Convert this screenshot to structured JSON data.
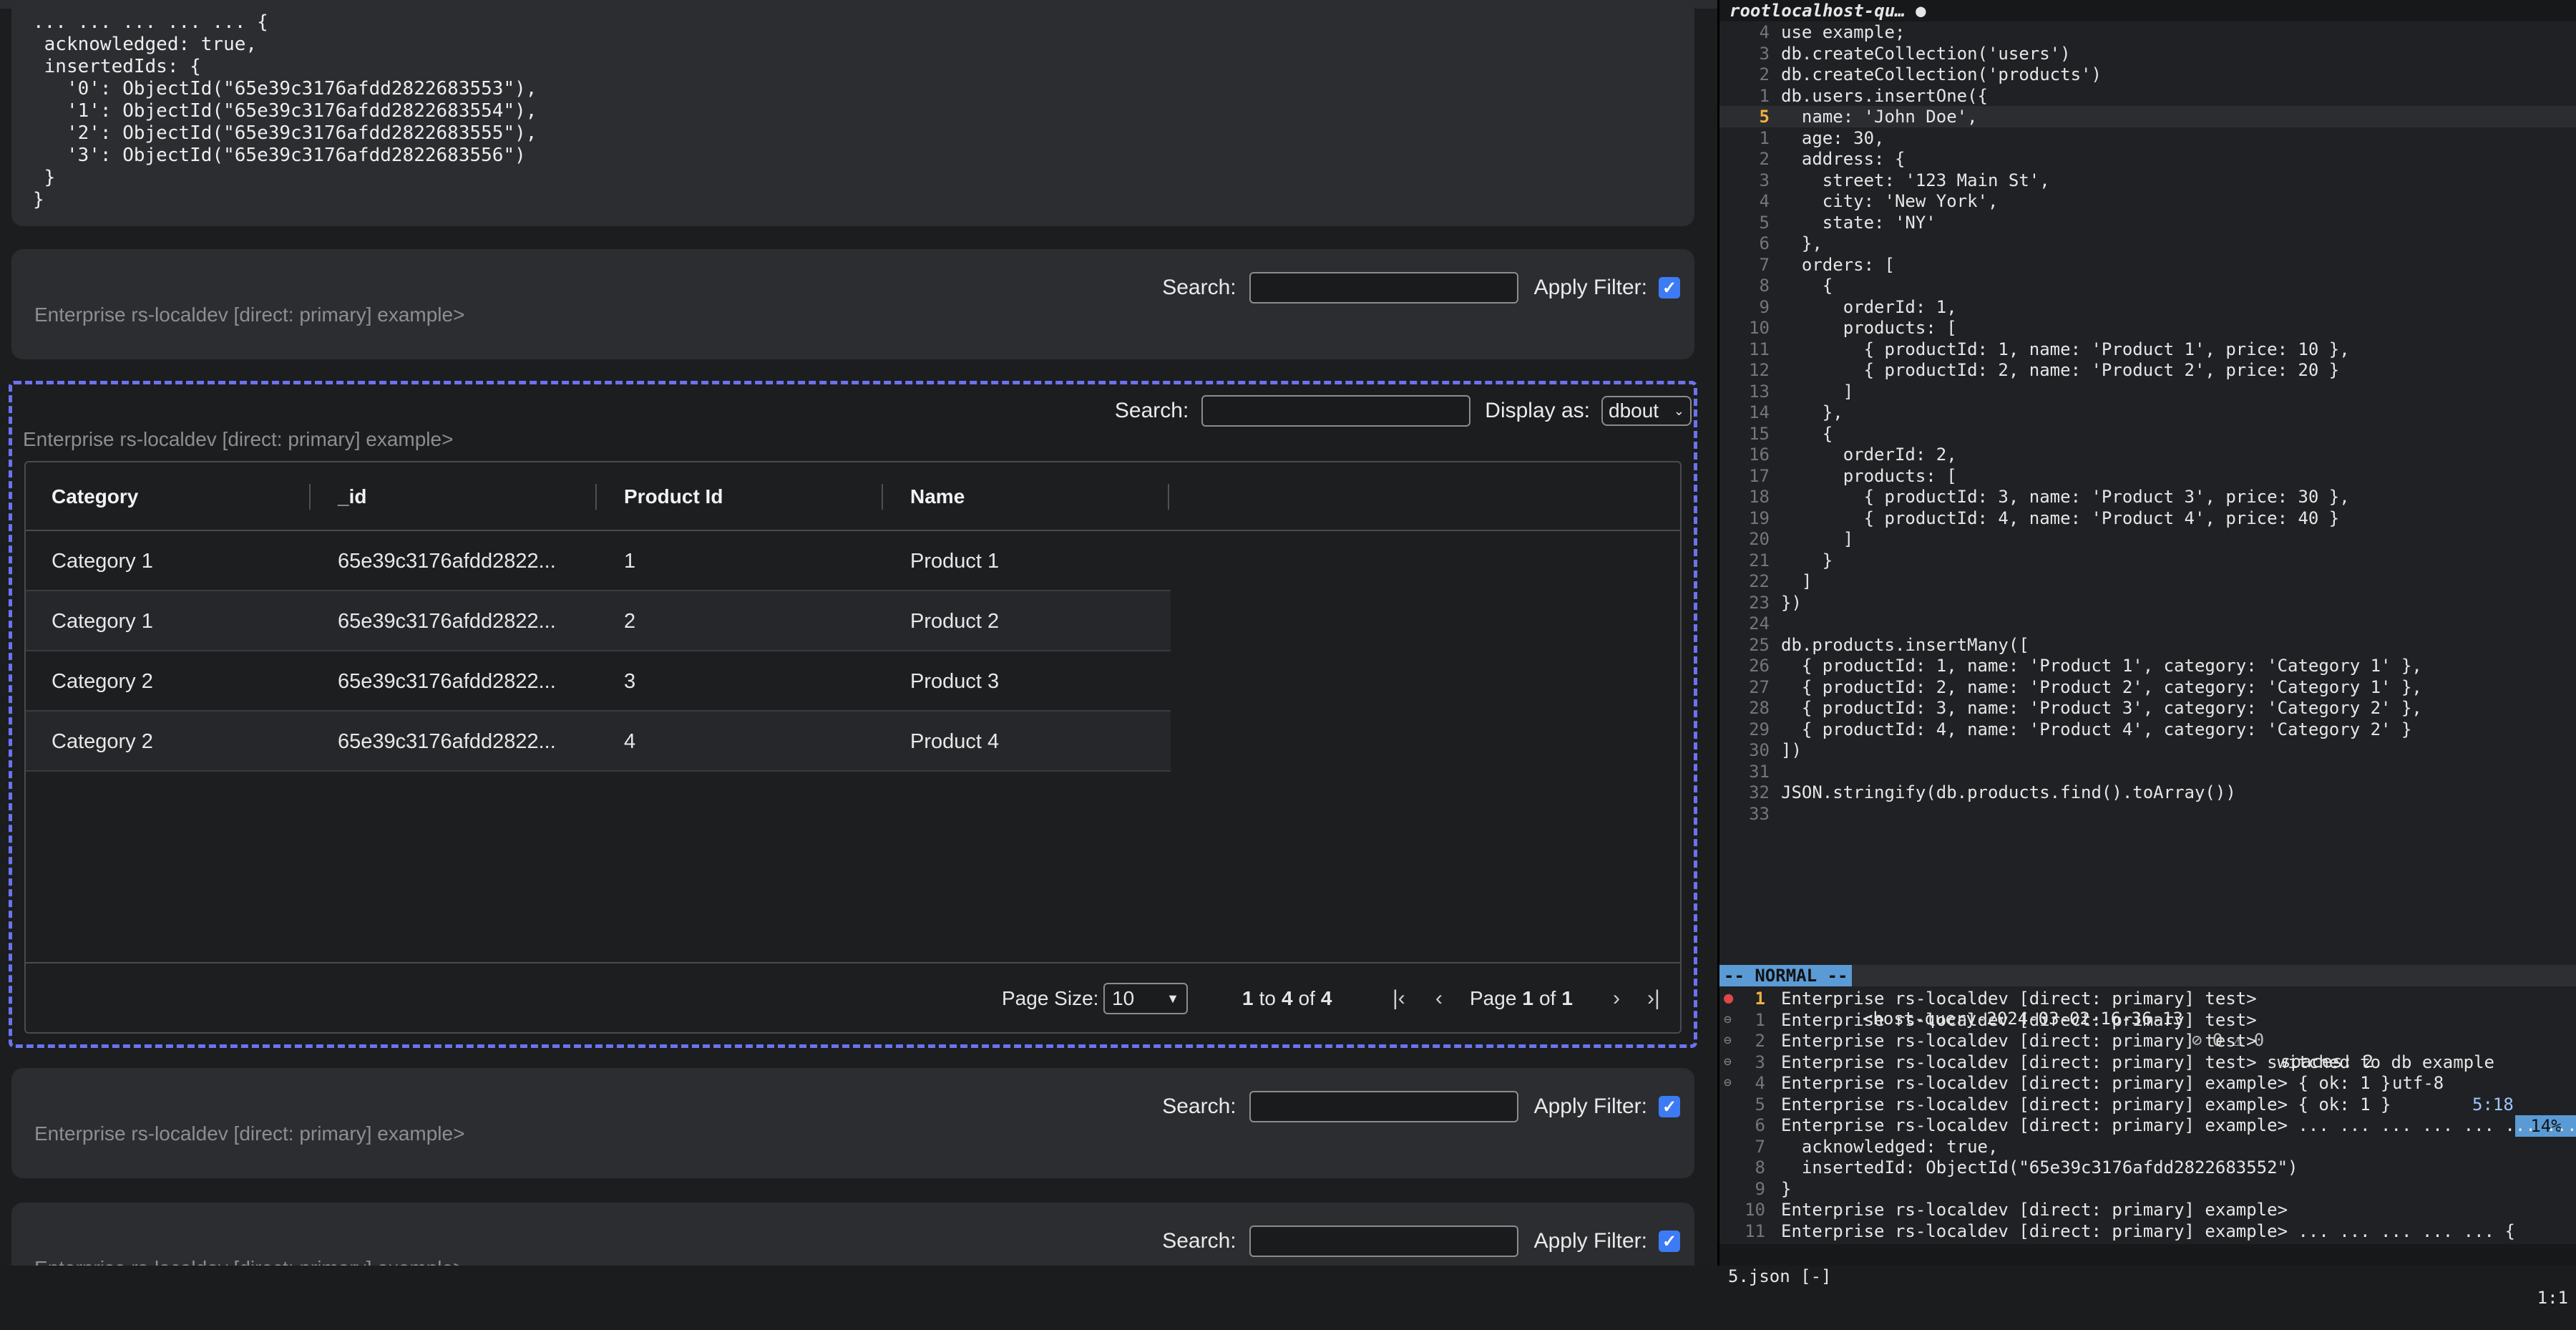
{
  "left": {
    "output_lines": [
      "... ... ... ... ... {",
      " acknowledged: true,",
      " insertedIds: {",
      "   '0': ObjectId(\"65e39c3176afdd2822683553\"),",
      "   '1': ObjectId(\"65e39c3176afdd2822683554\"),",
      "   '2': ObjectId(\"65e39c3176afdd2822683555\"),",
      "   '3': ObjectId(\"65e39c3176afdd2822683556\")",
      " }",
      "}"
    ],
    "cells": [
      {
        "search_label": "Search:",
        "filter_label": "Apply Filter:",
        "prompt": "Enterprise rs-localdev [direct: primary] example>"
      },
      {
        "search_label": "Search:",
        "filter_label": "Apply Filter:",
        "prompt": "Enterprise rs-localdev [direct: primary] example>"
      },
      {
        "search_label": "Search:",
        "filter_label": "Apply Filter:",
        "prompt": "Enterprise rs-localdev [direct: primary] example>"
      }
    ],
    "active": {
      "search_label": "Search:",
      "display_label": "Display as:",
      "display_value": "dbout",
      "prompt": "Enterprise rs-localdev [direct: primary] example>",
      "columns": [
        "Category",
        "_id",
        "Product Id",
        "Name"
      ],
      "rows": [
        [
          "Category 1",
          "65e39c3176afdd2822...",
          "1",
          "Product 1"
        ],
        [
          "Category 1",
          "65e39c3176afdd2822...",
          "2",
          "Product 2"
        ],
        [
          "Category 2",
          "65e39c3176afdd2822...",
          "3",
          "Product 3"
        ],
        [
          "Category 2",
          "65e39c3176afdd2822...",
          "4",
          "Product 4"
        ]
      ],
      "page_size_label": "Page Size:",
      "page_size": "10",
      "range_from": "1",
      "range_to_word": "to",
      "range_to": "4",
      "range_of_word": "of",
      "range_total": "4",
      "page_word": "Page",
      "page_current": "1",
      "page_of_word": "of",
      "page_total": "1",
      "nav": {
        "first": "|‹",
        "prev": "‹",
        "next": "›",
        "last": "›|"
      }
    }
  },
  "editor": {
    "tab_title": "rootlocalhost-qu… ●",
    "lines": [
      {
        "num": "4",
        "text": "use example;"
      },
      {
        "num": "3",
        "text": "db.createCollection('users')"
      },
      {
        "num": "2",
        "text": "db.createCollection('products')"
      },
      {
        "num": "1",
        "text": "db.users.insertOne({"
      },
      {
        "num": "5",
        "text": "  name: 'John Doe',",
        "current": true
      },
      {
        "num": "1",
        "text": "  age: 30,"
      },
      {
        "num": "2",
        "text": "  address: {"
      },
      {
        "num": "3",
        "text": "    street: '123 Main St',"
      },
      {
        "num": "4",
        "text": "    city: 'New York',"
      },
      {
        "num": "5",
        "text": "    state: 'NY'"
      },
      {
        "num": "6",
        "text": "  },"
      },
      {
        "num": "7",
        "text": "  orders: ["
      },
      {
        "num": "8",
        "text": "    {"
      },
      {
        "num": "9",
        "text": "      orderId: 1,"
      },
      {
        "num": "10",
        "text": "      products: ["
      },
      {
        "num": "11",
        "text": "        { productId: 1, name: 'Product 1', price: 10 },"
      },
      {
        "num": "12",
        "text": "        { productId: 2, name: 'Product 2', price: 20 }"
      },
      {
        "num": "13",
        "text": "      ]"
      },
      {
        "num": "14",
        "text": "    },"
      },
      {
        "num": "15",
        "text": "    {"
      },
      {
        "num": "16",
        "text": "      orderId: 2,"
      },
      {
        "num": "17",
        "text": "      products: ["
      },
      {
        "num": "18",
        "text": "        { productId: 3, name: 'Product 3', price: 30 },"
      },
      {
        "num": "19",
        "text": "        { productId: 4, name: 'Product 4', price: 40 }"
      },
      {
        "num": "20",
        "text": "      ]"
      },
      {
        "num": "21",
        "text": "    }"
      },
      {
        "num": "22",
        "text": "  ]"
      },
      {
        "num": "23",
        "text": "})"
      },
      {
        "num": "24",
        "text": ""
      },
      {
        "num": "25",
        "text": "db.products.insertMany(["
      },
      {
        "num": "26",
        "text": "  { productId: 1, name: 'Product 1', category: 'Category 1' },"
      },
      {
        "num": "27",
        "text": "  { productId: 2, name: 'Product 2', category: 'Category 1' },"
      },
      {
        "num": "28",
        "text": "  { productId: 3, name: 'Product 3', category: 'Category 2' },"
      },
      {
        "num": "29",
        "text": "  { productId: 4, name: 'Product 4', category: 'Category 2' }"
      },
      {
        "num": "30",
        "text": "])"
      },
      {
        "num": "31",
        "text": ""
      },
      {
        "num": "32",
        "text": "JSON.stringify(db.products.find().toArray())"
      },
      {
        "num": "33",
        "text": ""
      }
    ],
    "status": {
      "mode": "-- NORMAL --",
      "file": "<host-query-2024-03-02-16-36-13",
      "diagnostics": "⊘ 0 ⚠ 0",
      "spaces": "spaces: 2",
      "encoding": "utf-8",
      "position": "5:18",
      "percent": "14%"
    },
    "terminal": [
      {
        "num": "1",
        "text": "Enterprise rs-localdev [direct: primary] test>",
        "mark": "●",
        "current": true
      },
      {
        "num": "1",
        "text": "Enterprise rs-localdev [direct: primary] test>",
        "mark": "⊖"
      },
      {
        "num": "2",
        "text": "Enterprise rs-localdev [direct: primary] test>",
        "mark": "⊖"
      },
      {
        "num": "3",
        "text": "Enterprise rs-localdev [direct: primary] test> switched to db example",
        "mark": "⊖"
      },
      {
        "num": "4",
        "text": "Enterprise rs-localdev [direct: primary] example> { ok: 1 }",
        "mark": "⊖"
      },
      {
        "num": "5",
        "text": "Enterprise rs-localdev [direct: primary] example> { ok: 1 }",
        "mark": ""
      },
      {
        "num": "6",
        "text": "Enterprise rs-localdev [direct: primary] example> ... ... ... ... ... ... ... .",
        "mark": ""
      },
      {
        "num": "7",
        "text": "  acknowledged: true,",
        "mark": ""
      },
      {
        "num": "8",
        "text": "  insertedId: ObjectId(\"65e39c3176afdd2822683552\")",
        "mark": ""
      },
      {
        "num": "9",
        "text": "}",
        "mark": ""
      },
      {
        "num": "10",
        "text": "Enterprise rs-localdev [direct: primary] example>",
        "mark": ""
      },
      {
        "num": "11",
        "text": "Enterprise rs-localdev [direct: primary] example> ... ... ... ... ... {",
        "mark": ""
      }
    ],
    "bottom_left": "5.json [-]",
    "bottom_right": "1:1"
  }
}
